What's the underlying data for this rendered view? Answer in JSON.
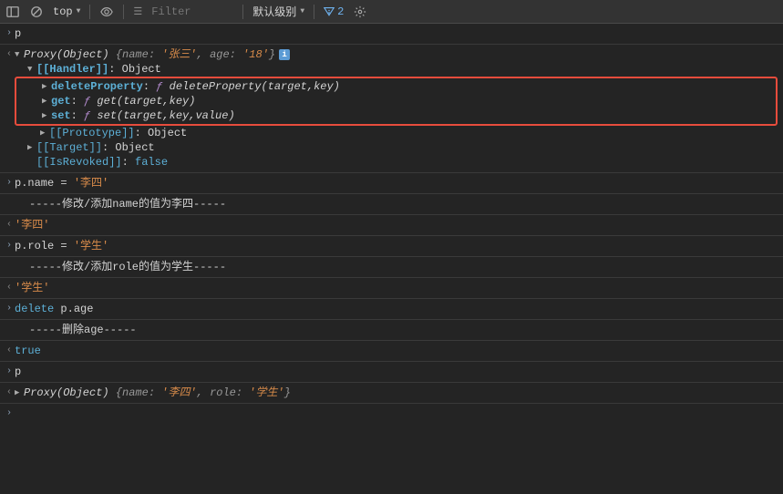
{
  "toolbar": {
    "context": "top",
    "filter_placeholder": "Filter",
    "level_label": "默认级别",
    "issue_count": "2"
  },
  "rows": {
    "r1": "p",
    "r2_proxy": "Proxy(Object)",
    "r2_obj_open": "{",
    "r2_name_k": "name",
    "r2_name_v": "'张三'",
    "r2_age_k": "age",
    "r2_age_v": "'18'",
    "r2_obj_close": "}",
    "r3_handler": "[[Handler]]",
    "r3_object": "Object",
    "r4_k": "deleteProperty",
    "r4_f": "ƒ",
    "r4_v": "deleteProperty(target,key)",
    "r5_k": "get",
    "r5_f": "ƒ",
    "r5_v": "get(target,key)",
    "r6_k": "set",
    "r6_f": "ƒ",
    "r6_v": "set(target,key,value)",
    "r7_proto": "[[Prototype]]",
    "r7_object": "Object",
    "r8_target": "[[Target]]",
    "r8_object": "Object",
    "r9_revoked": "[[IsRevoked]]",
    "r9_false": "false",
    "r10_expr": "p.name = ",
    "r10_val": "'李四'",
    "r11_log": "-----修改/添加name的值为李四-----",
    "r12_val": "'李四'",
    "r13_expr": "p.role = ",
    "r13_val": "'学生'",
    "r14_log": "-----修改/添加role的值为学生-----",
    "r15_val": "'学生'",
    "r16_expr_del": "delete",
    "r16_expr_rest": " p.age",
    "r17_log": "-----删除age-----",
    "r18_true": "true",
    "r19": "p",
    "r20_proxy": "Proxy(Object)",
    "r20_obj_open": "{",
    "r20_name_k": "name",
    "r20_name_v": "'李四'",
    "r20_role_k": "role",
    "r20_role_v": "'学生'",
    "r20_obj_close": "}"
  }
}
